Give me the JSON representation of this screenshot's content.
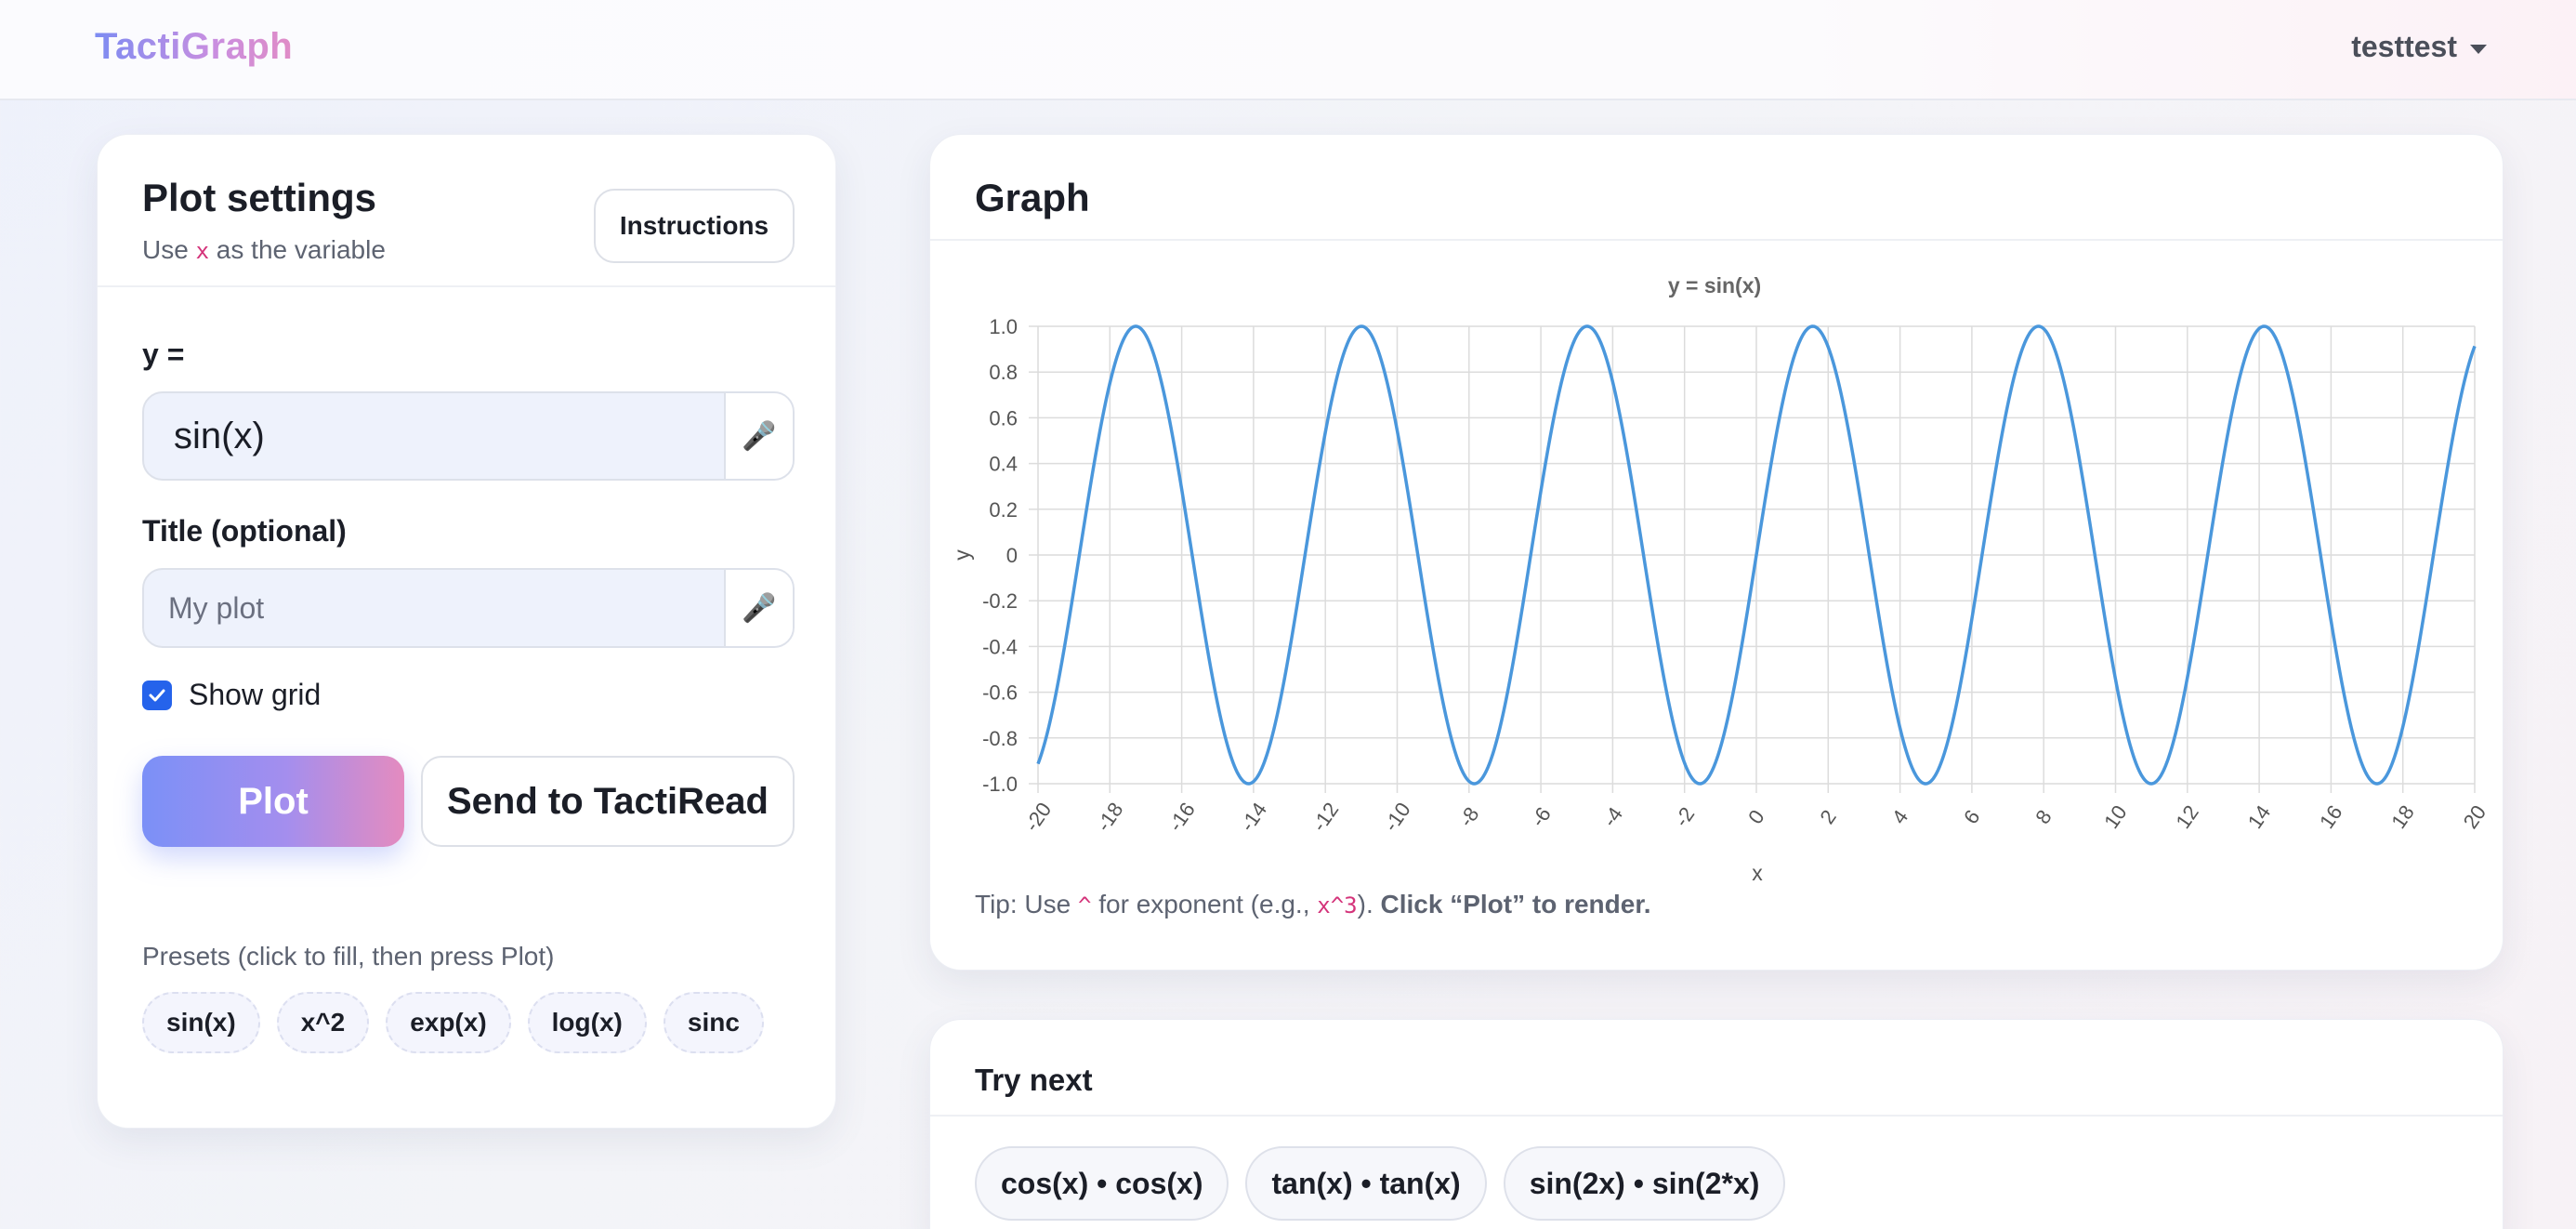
{
  "nav": {
    "brand": "TactiGraph",
    "user": "testtest"
  },
  "settings": {
    "title": "Plot settings",
    "subtitle_prefix": "Use ",
    "subtitle_var": "x",
    "subtitle_suffix": " as the variable",
    "instructions_label": "Instructions",
    "y_label": "y =",
    "y_value": "sin(x)",
    "title_label": "Title (optional)",
    "title_placeholder": "My plot",
    "title_value": "",
    "show_grid_label": "Show grid",
    "show_grid": true,
    "plot_label": "Plot",
    "send_label": "Send to TactiRead",
    "presets_label": "Presets (click to fill, then press Plot)",
    "presets": [
      "sin(x)",
      "x^2",
      "exp(x)",
      "log(x)",
      "sinc"
    ]
  },
  "graph": {
    "title": "Graph",
    "tip_prefix": "Tip: Use ",
    "tip_caret": "^",
    "tip_mid": " for exponent (e.g., ",
    "tip_example": "x^3",
    "tip_close": ").",
    "tip_bold": "Click “Plot” to render."
  },
  "try_next": {
    "title": "Try next",
    "items": [
      "cos(x) • cos(x)",
      "tan(x) • tan(x)",
      "sin(2x) • sin(2*x)"
    ]
  },
  "icons": {
    "mic": "microphone-icon",
    "check": "check-icon",
    "caret": "caret-down-icon"
  },
  "colors": {
    "line": "#4a97dc",
    "accent": "#2563eb",
    "grid": "#dcdcdc"
  },
  "chart_data": {
    "type": "line",
    "title": "y = sin(x)",
    "xlabel": "x",
    "ylabel": "y",
    "function": "sin(x)",
    "xlim": [
      -20,
      20
    ],
    "ylim": [
      -1,
      1
    ],
    "grid": true,
    "xticks": [
      -20,
      -18,
      -16,
      -14,
      -12,
      -10,
      -8,
      -6,
      -4,
      -2,
      0,
      2,
      4,
      6,
      8,
      10,
      12,
      14,
      16,
      18,
      20
    ],
    "yticks": [
      "1.0",
      "0.8",
      "0.6",
      "0.4",
      "0.2",
      "0",
      "-0.2",
      "-0.4",
      "-0.6",
      "-0.8",
      "-1.0"
    ],
    "series": [
      {
        "name": "y = sin(x)",
        "x": [
          -20,
          -18,
          -16,
          -14,
          -12,
          -10,
          -8,
          -6,
          -4,
          -2,
          0,
          2,
          4,
          6,
          8,
          10,
          12,
          14,
          16,
          18,
          20
        ],
        "y": [
          -0.91,
          0.75,
          0.29,
          -0.99,
          0.54,
          0.54,
          -0.99,
          0.28,
          0.76,
          -0.91,
          0,
          0.91,
          -0.76,
          -0.28,
          0.99,
          -0.54,
          -0.54,
          0.99,
          -0.29,
          -0.75,
          0.91
        ]
      }
    ]
  }
}
